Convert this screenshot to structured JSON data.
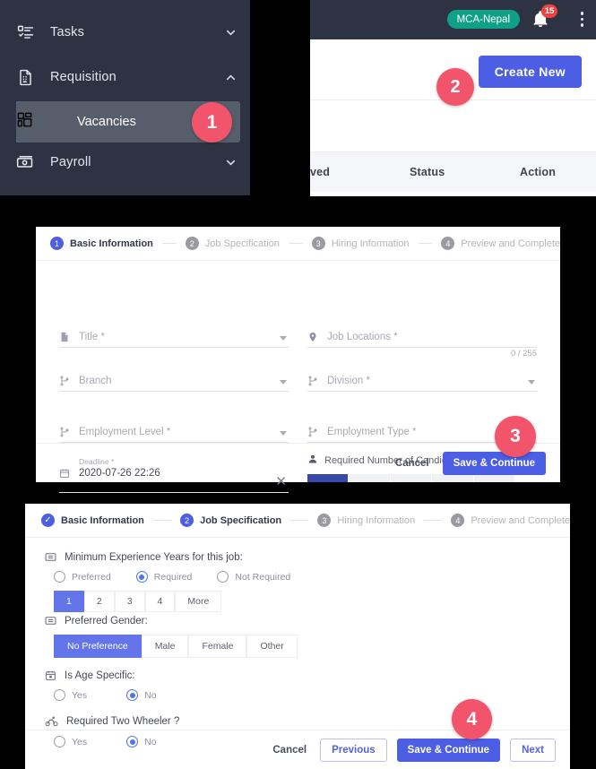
{
  "sidebar": {
    "items": [
      {
        "label": "Tasks",
        "icon": "tasklist-icon",
        "chevron": "chevron-down-icon"
      },
      {
        "label": "Requisition",
        "icon": "document-icon",
        "chevron": "chevron-up-icon"
      },
      {
        "label": "Payroll",
        "icon": "money-icon",
        "chevron": "chevron-down-icon"
      }
    ],
    "sub_item": {
      "label": "Vacancies",
      "icon": "grid-icon"
    }
  },
  "topbar": {
    "org_badge": "MCA-Nepal",
    "notification_count": "15",
    "bell_icon": "bell-icon",
    "menu_icon": "kebab-menu-icon"
  },
  "list_page": {
    "create_button": "Create New",
    "table_headers": [
      "ved",
      "Status",
      "Action"
    ]
  },
  "callouts": [
    {
      "number": "1"
    },
    {
      "number": "2"
    },
    {
      "number": "3"
    },
    {
      "number": "4"
    }
  ],
  "stepper": {
    "steps": [
      {
        "num": "1",
        "label": "Basic Information"
      },
      {
        "num": "2",
        "label": "Job Specification"
      },
      {
        "num": "3",
        "label": "Hiring Information"
      },
      {
        "num": "4",
        "label": "Preview and Complete"
      }
    ],
    "check_glyph": "✓"
  },
  "basic_form": {
    "title": {
      "label": "Title *",
      "icon": "document-icon"
    },
    "job_locations": {
      "label": "Job Locations *",
      "icon": "location-pin-icon",
      "counter": "0 / 255"
    },
    "branch": {
      "label": "Branch",
      "icon": "hierarchy-icon"
    },
    "division": {
      "label": "Division *",
      "icon": "hierarchy-icon"
    },
    "employment_level": {
      "label": "Employment Level *",
      "icon": "hierarchy-icon"
    },
    "employment_type": {
      "label": "Employment Type *",
      "icon": "hierarchy-icon"
    },
    "deadline": {
      "label": "Deadline *",
      "value": "2020-07-26 22:26",
      "icon": "calendar-icon",
      "clear": "✕"
    },
    "candidates": {
      "label": "Required Number of Candidates *:",
      "icon": "person-icon",
      "segments": 5,
      "filled": 1
    },
    "footer": {
      "cancel": "Cancel",
      "save": "Save & Continue"
    }
  },
  "spec_form": {
    "experience": {
      "label": "Minimum Experience Years for this job:",
      "icon": "list-box-icon",
      "options": [
        "Preferred",
        "Required",
        "Not Required"
      ],
      "selected": "Required",
      "years": [
        "1",
        "2",
        "3",
        "4",
        "More"
      ],
      "selected_year": "1"
    },
    "gender": {
      "label": "Preferred Gender:",
      "icon": "list-box-icon",
      "options": [
        "No Preference",
        "Male",
        "Female",
        "Other"
      ],
      "selected": "No Preference"
    },
    "age_specific": {
      "label": "Is Age Specific:",
      "icon": "calendar-icon",
      "options": [
        "Yes",
        "No"
      ],
      "selected": "No"
    },
    "two_wheeler": {
      "label": "Required Two Wheeler ?",
      "icon": "bicycle-icon",
      "options": [
        "Yes",
        "No"
      ],
      "selected": "No"
    },
    "footer": {
      "cancel": "Cancel",
      "previous": "Previous",
      "save": "Save & Continue",
      "next": "Next"
    }
  },
  "colors": {
    "sidebar_bg": "#2e3344",
    "accent_blue": "#3d9bf0",
    "primary": "#4c5ee3",
    "badge_pink": "#f2546b",
    "teal": "#0ea187",
    "notification_red": "#f04141"
  }
}
